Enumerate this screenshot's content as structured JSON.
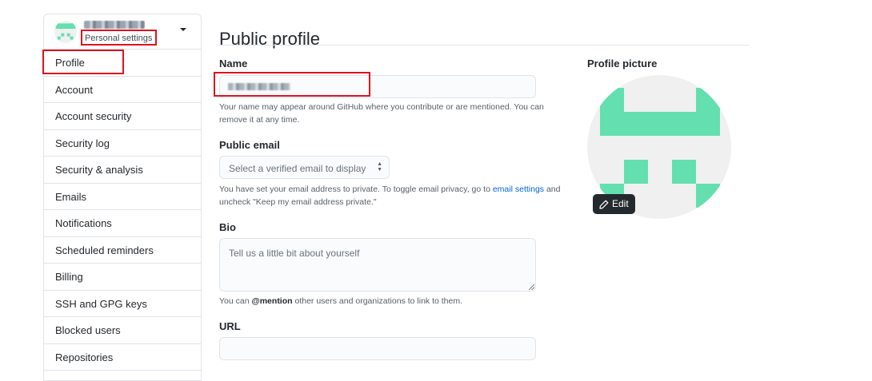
{
  "sidebar": {
    "subtitle": "Personal settings",
    "items": [
      {
        "label": "Profile"
      },
      {
        "label": "Account"
      },
      {
        "label": "Account security"
      },
      {
        "label": "Security log"
      },
      {
        "label": "Security & analysis"
      },
      {
        "label": "Emails"
      },
      {
        "label": "Notifications"
      },
      {
        "label": "Scheduled reminders"
      },
      {
        "label": "Billing"
      },
      {
        "label": "SSH and GPG keys"
      },
      {
        "label": "Blocked users"
      },
      {
        "label": "Repositories"
      }
    ]
  },
  "main": {
    "title": "Public profile",
    "name": {
      "label": "Name",
      "note": "Your name may appear around GitHub where you contribute or are mentioned. You can remove it at any time."
    },
    "email": {
      "label": "Public email",
      "selected": "Select a verified email to display",
      "note_part1": "You have set your email address to private. To toggle email privacy, go to ",
      "note_link": "email settings",
      "note_part2": " and uncheck \"Keep my email address private.\""
    },
    "bio": {
      "label": "Bio",
      "placeholder": "Tell us a little bit about yourself",
      "note_part1": "You can ",
      "note_mention": "@mention",
      "note_part2": " other users and organizations to link to them."
    },
    "url": {
      "label": "URL"
    }
  },
  "profile_picture": {
    "label": "Profile picture",
    "edit_label": "Edit"
  },
  "colors": {
    "avatar_green": "#63dfb0",
    "highlight_red": "#e0121f",
    "link_blue": "#0366d6"
  }
}
